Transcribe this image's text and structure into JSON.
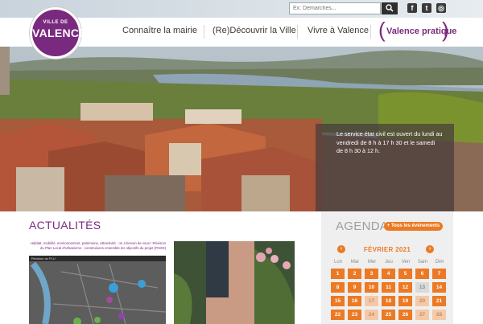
{
  "header": {
    "search_placeholder": "Ex: Démarches...",
    "social": [
      {
        "icon": "facebook-icon",
        "glyph": "f"
      },
      {
        "icon": "twitter-icon",
        "glyph": "t"
      },
      {
        "icon": "instagram-icon",
        "glyph": "◎"
      }
    ]
  },
  "logo": {
    "small": "VILLE DE",
    "big": "VALENCE"
  },
  "nav": {
    "items": [
      "Connaître la mairie",
      "(Re)Découvrir la Ville",
      "Vivre à Valence"
    ],
    "active": "Valence pratique"
  },
  "hero": {
    "notice": "Le service état civil est ouvert du lundi au vendredi de 8 h à 17 h 30 et le samedi de 8 h 30 à 12 h.",
    "slides": 3,
    "active_slide": 2
  },
  "actualites": {
    "title": "ACTUALITÉS",
    "card1_text": "Habitat, mobilité, environnement, patrimoine, attractivité : on a besoin de vous ! Révision du Plan Local d'Urbanisme : construisons ensemble les objectifs du projet (PADD)",
    "map_header": "Révision du PLU"
  },
  "agenda": {
    "title": "AGENDA",
    "button": "+ Tous les événements",
    "month": "FÉVRIER 2021",
    "prev": "‹",
    "next": "›",
    "weekdays": [
      "Lun",
      "Mar",
      "Mer",
      "Jeu",
      "Ven",
      "Sam",
      "Dim"
    ],
    "weeks": [
      [
        "1",
        "2",
        "3",
        "4",
        "5",
        "6",
        "7"
      ],
      [
        "8",
        "9",
        "10",
        "11",
        "12",
        "13",
        "14"
      ],
      [
        "15",
        "16",
        "17",
        "18",
        "19",
        "20",
        "21"
      ],
      [
        "22",
        "23",
        "24",
        "25",
        "26",
        "27",
        "28"
      ]
    ],
    "colors": {
      "accent": "#ec7a24",
      "brand": "#7a2a7e"
    }
  }
}
